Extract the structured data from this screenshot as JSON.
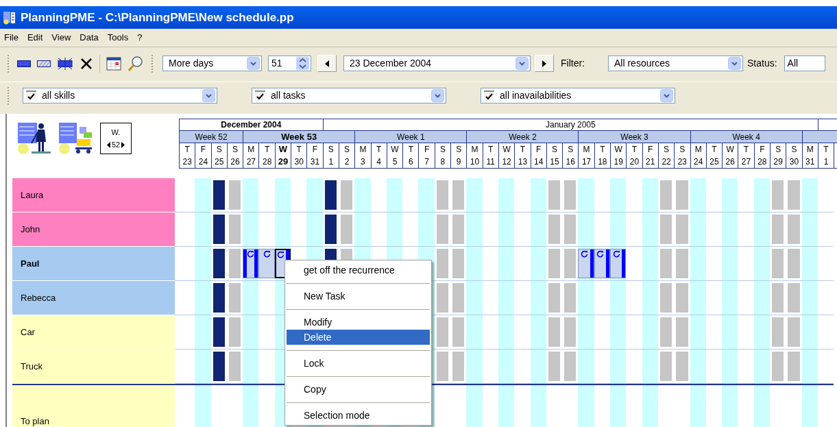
{
  "window": {
    "title": "PlanningPME - C:\\PlanningPME\\New schedule.pp"
  },
  "menu": [
    "File",
    "Edit",
    "View",
    "Data",
    "Tools",
    "?"
  ],
  "toolbar": {
    "view_mode": "More days",
    "day_count": "51",
    "date": "23 December 2004",
    "filter_label": "Filter:",
    "filter": "All resources",
    "status_label": "Status:",
    "status": "All"
  },
  "filters": [
    {
      "label": "all skills",
      "checked": true
    },
    {
      "label": "all tasks",
      "checked": true
    },
    {
      "label": "all inavailabilities",
      "checked": true
    }
  ],
  "week_nav": {
    "label": "W.",
    "value": "52"
  },
  "months": [
    {
      "label": "December 2004",
      "current": true
    },
    {
      "label": "January 2005",
      "current": false
    }
  ],
  "weeks": [
    {
      "label": "Week 52",
      "current": false
    },
    {
      "label": "Week 53",
      "current": true
    },
    {
      "label": "Week 1",
      "current": false
    },
    {
      "label": "Week 2",
      "current": false
    },
    {
      "label": "Week 3",
      "current": false
    },
    {
      "label": "Week 4",
      "current": false
    }
  ],
  "days": [
    {
      "letter": "T",
      "date": "23",
      "kind": "plain",
      "today": false
    },
    {
      "letter": "F",
      "date": "24",
      "kind": "stripe",
      "today": false
    },
    {
      "letter": "S",
      "date": "25",
      "kind": "holiday",
      "today": false
    },
    {
      "letter": "S",
      "date": "26",
      "kind": "weekend",
      "today": false
    },
    {
      "letter": "M",
      "date": "27",
      "kind": "stripe",
      "today": false
    },
    {
      "letter": "T",
      "date": "28",
      "kind": "plain",
      "today": false
    },
    {
      "letter": "W",
      "date": "29",
      "kind": "stripe",
      "today": true
    },
    {
      "letter": "T",
      "date": "30",
      "kind": "plain",
      "today": false
    },
    {
      "letter": "F",
      "date": "31",
      "kind": "stripe",
      "today": false
    },
    {
      "letter": "S",
      "date": "1",
      "kind": "holiday",
      "today": false
    },
    {
      "letter": "S",
      "date": "2",
      "kind": "weekend",
      "today": false
    },
    {
      "letter": "M",
      "date": "3",
      "kind": "stripe",
      "today": false
    },
    {
      "letter": "T",
      "date": "4",
      "kind": "plain",
      "today": false
    },
    {
      "letter": "W",
      "date": "5",
      "kind": "stripe",
      "today": false
    },
    {
      "letter": "T",
      "date": "6",
      "kind": "plain",
      "today": false
    },
    {
      "letter": "F",
      "date": "7",
      "kind": "stripe",
      "today": false
    },
    {
      "letter": "S",
      "date": "8",
      "kind": "weekend",
      "today": false
    },
    {
      "letter": "S",
      "date": "9",
      "kind": "weekend",
      "today": false
    },
    {
      "letter": "M",
      "date": "10",
      "kind": "stripe",
      "today": false
    },
    {
      "letter": "T",
      "date": "11",
      "kind": "plain",
      "today": false
    },
    {
      "letter": "W",
      "date": "12",
      "kind": "stripe",
      "today": false
    },
    {
      "letter": "T",
      "date": "13",
      "kind": "plain",
      "today": false
    },
    {
      "letter": "F",
      "date": "14",
      "kind": "stripe",
      "today": false
    },
    {
      "letter": "S",
      "date": "15",
      "kind": "weekend",
      "today": false
    },
    {
      "letter": "S",
      "date": "16",
      "kind": "weekend",
      "today": false
    },
    {
      "letter": "M",
      "date": "17",
      "kind": "stripe",
      "today": false
    },
    {
      "letter": "T",
      "date": "18",
      "kind": "plain",
      "today": false
    },
    {
      "letter": "W",
      "date": "19",
      "kind": "stripe",
      "today": false
    },
    {
      "letter": "T",
      "date": "20",
      "kind": "plain",
      "today": false
    },
    {
      "letter": "F",
      "date": "21",
      "kind": "stripe",
      "today": false
    },
    {
      "letter": "S",
      "date": "22",
      "kind": "weekend",
      "today": false
    },
    {
      "letter": "S",
      "date": "23",
      "kind": "weekend",
      "today": false
    },
    {
      "letter": "M",
      "date": "24",
      "kind": "stripe",
      "today": false
    },
    {
      "letter": "T",
      "date": "25",
      "kind": "plain",
      "today": false
    },
    {
      "letter": "W",
      "date": "26",
      "kind": "stripe",
      "today": false
    },
    {
      "letter": "T",
      "date": "27",
      "kind": "plain",
      "today": false
    },
    {
      "letter": "F",
      "date": "28",
      "kind": "stripe",
      "today": false
    },
    {
      "letter": "S",
      "date": "29",
      "kind": "weekend",
      "today": false
    },
    {
      "letter": "S",
      "date": "30",
      "kind": "weekend",
      "today": false
    },
    {
      "letter": "M",
      "date": "31",
      "kind": "stripe",
      "today": false
    },
    {
      "letter": "T",
      "date": "1",
      "kind": "plain",
      "today": false
    }
  ],
  "resources": [
    {
      "name": "Laura",
      "color": "#ff80c0",
      "selected": false
    },
    {
      "name": "John",
      "color": "#ff80c0",
      "selected": false
    },
    {
      "name": "Paul",
      "color": "#a6caf0",
      "selected": true,
      "cells": [
        {
          "kind": "free"
        },
        {
          "kind": "free"
        },
        {
          "kind": "free"
        },
        {
          "kind": "free"
        },
        {
          "kind": "task",
          "bar_left": true,
          "bar_right": true,
          "selected": false
        },
        {
          "kind": "task",
          "bar_left": false,
          "bar_right": false,
          "selected": false
        },
        {
          "kind": "task",
          "bar_left": false,
          "bar_right": true,
          "selected": true
        },
        {
          "kind": "free"
        },
        {
          "kind": "free"
        },
        {
          "kind": "free"
        },
        {
          "kind": "free"
        },
        {
          "kind": "free"
        },
        {
          "kind": "free"
        },
        {
          "kind": "free"
        },
        {
          "kind": "free"
        },
        {
          "kind": "free"
        },
        {
          "kind": "free"
        },
        {
          "kind": "free"
        },
        {
          "kind": "free"
        },
        {
          "kind": "free"
        },
        {
          "kind": "free"
        },
        {
          "kind": "free"
        },
        {
          "kind": "free"
        },
        {
          "kind": "free"
        },
        {
          "kind": "free"
        },
        {
          "kind": "task",
          "bar_left": false,
          "bar_right": true,
          "selected": false
        },
        {
          "kind": "task",
          "bar_left": false,
          "bar_right": true,
          "selected": false
        },
        {
          "kind": "task",
          "bar_left": false,
          "bar_right": true,
          "selected": false
        },
        {
          "kind": "free"
        },
        {
          "kind": "free"
        },
        {
          "kind": "free"
        },
        {
          "kind": "free"
        },
        {
          "kind": "free"
        },
        {
          "kind": "free"
        },
        {
          "kind": "free"
        },
        {
          "kind": "free"
        },
        {
          "kind": "free"
        },
        {
          "kind": "free"
        },
        {
          "kind": "free"
        },
        {
          "kind": "free"
        },
        {
          "kind": "free"
        }
      ]
    },
    {
      "name": "Rebecca",
      "color": "#a6caf0",
      "selected": false
    },
    {
      "name": "Car",
      "color": "#ffffc0",
      "selected": false
    },
    {
      "name": "Truck",
      "color": "#ffffc0",
      "selected": false
    }
  ],
  "unplanned": {
    "name": "To plan",
    "color": "#ffffc0"
  },
  "context_menu": [
    {
      "kind": "item",
      "label": "get off the recurrence",
      "selected": false
    },
    {
      "kind": "separator"
    },
    {
      "kind": "item",
      "label": "New Task",
      "selected": false
    },
    {
      "kind": "separator"
    },
    {
      "kind": "item",
      "label": "Modify",
      "selected": false
    },
    {
      "kind": "item",
      "label": "Delete",
      "selected": true
    },
    {
      "kind": "separator"
    },
    {
      "kind": "item",
      "label": "Lock",
      "selected": false
    },
    {
      "kind": "separator"
    },
    {
      "kind": "item",
      "label": "Copy",
      "selected": false
    },
    {
      "kind": "separator"
    },
    {
      "kind": "item",
      "label": "Selection mode",
      "selected": false
    }
  ]
}
